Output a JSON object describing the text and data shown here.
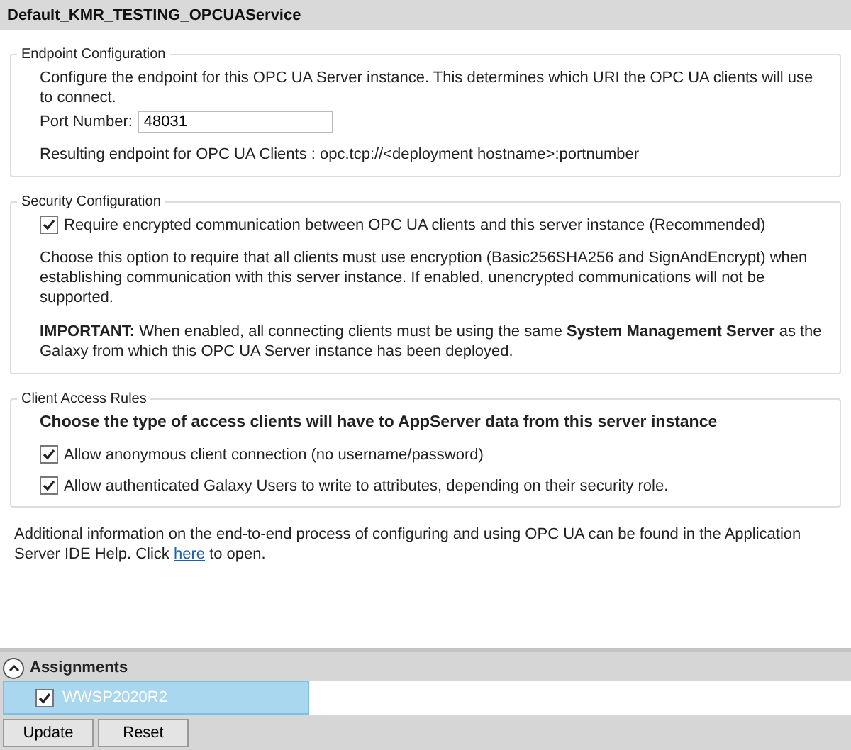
{
  "window": {
    "title": "Default_KMR_TESTING_OPCUAService"
  },
  "endpoint": {
    "legend": "Endpoint Configuration",
    "intro": "Configure the endpoint for this OPC UA Server instance. This determines which URI the OPC UA clients will use to connect.",
    "port_label": "Port Number:",
    "port_value": "48031",
    "result": "Resulting endpoint for OPC UA Clients : opc.tcp://<deployment hostname>:portnumber"
  },
  "security": {
    "legend": "Security Configuration",
    "option": {
      "label": "Require encrypted communication between OPC UA clients and this server instance (Recommended)",
      "checked": true
    },
    "description": "Choose this option to require that all clients must use encryption (Basic256SHA256 and SignAndEncrypt) when establishing communication with this server instance. If enabled, unencrypted communications will not be supported.",
    "important": "**IMPORTANT:** When enabled, all connecting clients must be using the same **System Management Server** as the Galaxy from which this OPC UA Server instance has been deployed."
  },
  "access": {
    "legend": "Client Access Rules",
    "heading": "Choose the type of access clients will have to AppServer data from this server instance",
    "options": [
      {
        "label": "Allow anonymous client connection (no username/password)",
        "checked": true
      },
      {
        "label": "Allow authenticated Galaxy Users to write to attributes, depending on their security role.",
        "checked": true
      }
    ]
  },
  "help": {
    "before": "Additional information on the end-to-end process of configuring and using OPC UA can be found in the Application Server IDE Help. Click ",
    "link": "here",
    "after": " to open."
  },
  "assignments": {
    "title": "Assignments",
    "expanded": true,
    "items": [
      {
        "label": "WWSP2020R2",
        "checked": true,
        "selected": true
      }
    ]
  },
  "buttons": [
    "Update",
    "Reset"
  ]
}
